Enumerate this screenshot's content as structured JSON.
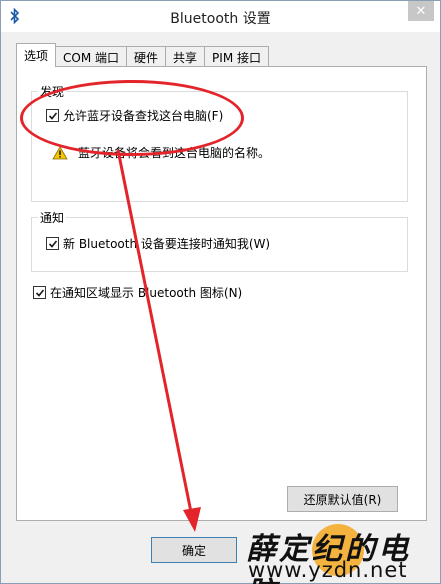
{
  "window": {
    "title": "Bluetooth 设置",
    "close_glyph": "✕"
  },
  "tabs": [
    {
      "label": "选项",
      "active": true
    },
    {
      "label": "COM 端口",
      "active": false
    },
    {
      "label": "硬件",
      "active": false
    },
    {
      "label": "共享",
      "active": false
    },
    {
      "label": "PIM 接口",
      "active": false
    }
  ],
  "discovery": {
    "group_label": "发现",
    "allow_discovery_label": "允许蓝牙设备查找这台电脑(F)",
    "allow_discovery_checked": true,
    "warning_text": "蓝牙设备将会看到这台电脑的名称。"
  },
  "notifications": {
    "group_label": "通知",
    "notify_label": "新 Bluetooth 设备要连接时通知我(W)",
    "notify_checked": true
  },
  "tray": {
    "label": "在通知区域显示 Bluetooth 图标(N)",
    "checked": true
  },
  "buttons": {
    "restore_defaults": "还原默认值(R)",
    "ok": "确定"
  },
  "watermark": {
    "text": "薛定纪的电脑",
    "url": "www.yzdn.net"
  },
  "colors": {
    "annotation_red": "#e3242b",
    "warning_yellow": "#f5c400"
  }
}
